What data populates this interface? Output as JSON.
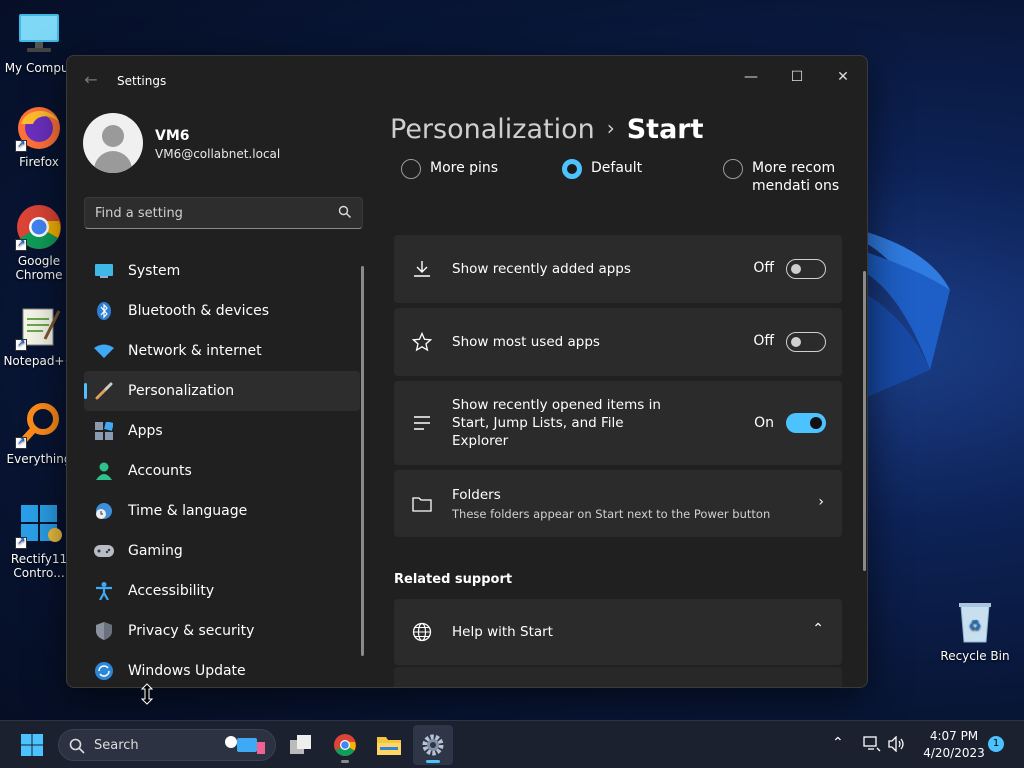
{
  "desktop": {
    "icons": [
      {
        "label": "My Comput"
      },
      {
        "label": "Firefox"
      },
      {
        "label": "Google Chrome"
      },
      {
        "label": "Notepad++"
      },
      {
        "label": "Everything"
      },
      {
        "label": "Rectify11 Contro..."
      },
      {
        "label": "Recycle Bin"
      }
    ]
  },
  "window": {
    "title": "Settings",
    "controls": {
      "minimize": "—",
      "maximize": "☐",
      "close": "✕"
    }
  },
  "profile": {
    "name": "VM6",
    "email": "VM6@collabnet.local"
  },
  "search": {
    "placeholder": "Find a setting"
  },
  "nav": {
    "items": [
      {
        "label": "System"
      },
      {
        "label": "Bluetooth & devices"
      },
      {
        "label": "Network & internet"
      },
      {
        "label": "Personalization",
        "active": true
      },
      {
        "label": "Apps"
      },
      {
        "label": "Accounts"
      },
      {
        "label": "Time & language"
      },
      {
        "label": "Gaming"
      },
      {
        "label": "Accessibility"
      },
      {
        "label": "Privacy & security"
      },
      {
        "label": "Windows Update"
      }
    ]
  },
  "main": {
    "breadcrumb": {
      "parent": "Personalization",
      "separator": "›",
      "current": "Start"
    },
    "layout_options": [
      {
        "label": "More pins",
        "selected": false
      },
      {
        "label": "Default",
        "selected": true
      },
      {
        "label": "More recommendati ons",
        "selected": false
      }
    ],
    "settings": [
      {
        "title": "Show recently added apps",
        "state": "Off",
        "icon": "download-icon"
      },
      {
        "title": "Show most used apps",
        "state": "Off",
        "icon": "star-icon"
      },
      {
        "title": "Show recently opened items in Start, Jump Lists, and File Explorer",
        "state": "On",
        "icon": "list-icon"
      }
    ],
    "folders": {
      "title": "Folders",
      "description": "These folders appear on Start next to the Power button"
    },
    "related_support": {
      "heading": "Related support",
      "help_title": "Help with Start"
    }
  },
  "taskbar": {
    "search_label": "Search",
    "time": "4:07 PM",
    "date": "4/20/2023",
    "notifications": "1"
  },
  "colors": {
    "accent": "#4cc2ff",
    "window_bg": "#202020",
    "card_bg": "#2b2b2b"
  }
}
